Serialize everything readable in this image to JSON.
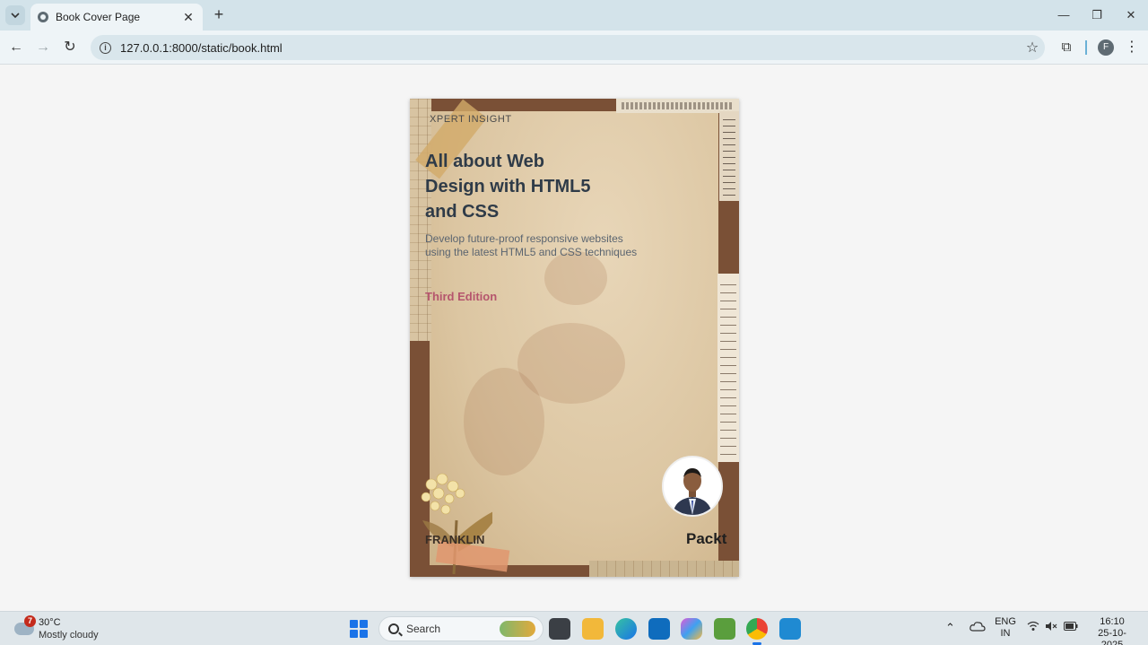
{
  "browser": {
    "tab_title": "Book Cover Page",
    "tab_close": "✕",
    "new_tab": "+",
    "url": "127.0.0.1:8000/static/book.html",
    "window_controls": {
      "minimize": "—",
      "maximize": "❐",
      "close": "✕"
    },
    "nav": {
      "back": "←",
      "forward": "→",
      "reload": "↻"
    },
    "bookmark": "☆",
    "extensions": "⧉",
    "profile_initial": "F",
    "menu": "⋮"
  },
  "book": {
    "series": "XPERT INSIGHT",
    "title": "All about Web Design with HTML5 and CSS",
    "subtitle": "Develop future-proof responsive websites using the latest HTML5 and CSS techniques",
    "edition": "Third Edition",
    "author": "FRANKLIN",
    "publisher": "Packt"
  },
  "taskbar": {
    "weather_badge": "7",
    "temperature": "30°C",
    "condition": "Mostly cloudy",
    "search_label": "Search",
    "language": "ENG",
    "region": "IN",
    "time": "16:10",
    "date": "25-10-2025"
  },
  "colors": {
    "frame": "#7a5036",
    "title": "#2f3b48",
    "edition": "#b5556d",
    "accent": "#1a73e8"
  }
}
